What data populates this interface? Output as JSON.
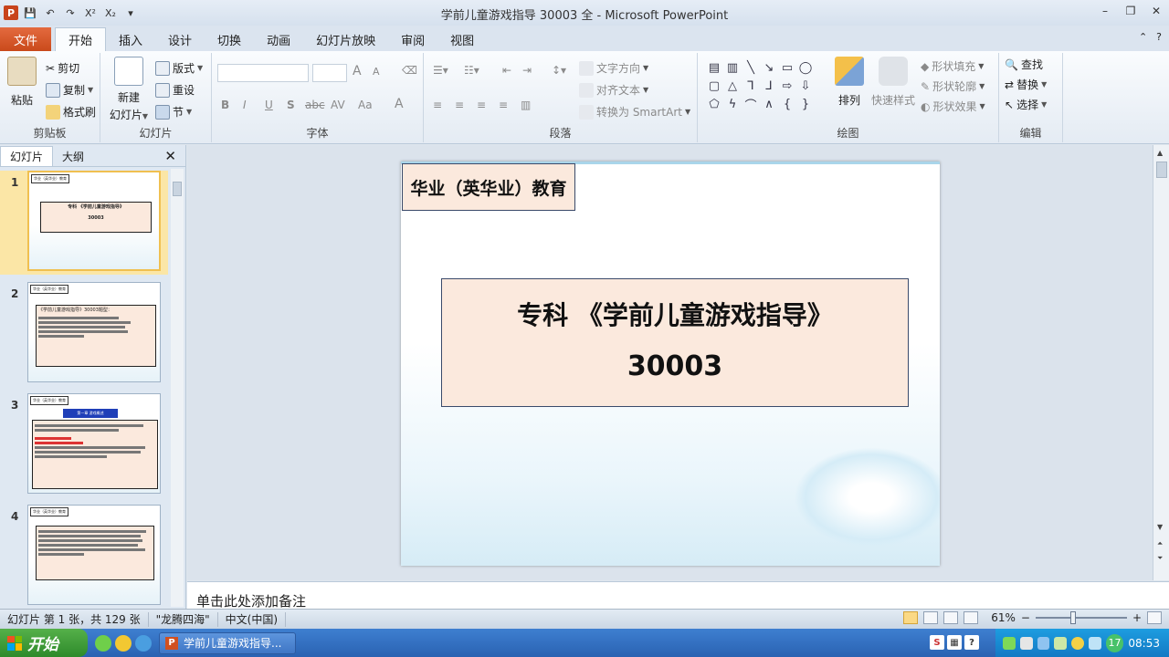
{
  "window": {
    "title": "学前儿童游戏指导  30003  全 - Microsoft PowerPoint",
    "app_logo": "P",
    "minimize_glyph": "–",
    "restore_glyph": "❐",
    "close_glyph": "✕",
    "help_glyph": "?",
    "collapse_glyph": "⌃"
  },
  "qat": {
    "save": "💾",
    "undo": "↶",
    "redo": "↷",
    "superscript": "X²",
    "subscript": "X₂",
    "customize": "▾"
  },
  "tabs": {
    "file": "文件",
    "home": "开始",
    "insert": "插入",
    "design": "设计",
    "transitions": "切换",
    "animations": "动画",
    "slideshow": "幻灯片放映",
    "review": "审阅",
    "view": "视图"
  },
  "ribbon": {
    "clipboard": {
      "label": "剪贴板",
      "paste": "粘贴",
      "cut": "剪切",
      "copy": "复制",
      "format_painter": "格式刷"
    },
    "slides": {
      "label": "幻灯片",
      "new_slide": "新建",
      "new_slide_sub": "幻灯片",
      "layout": "版式",
      "reset": "重设",
      "section": "节"
    },
    "font": {
      "label": "字体",
      "bold": "B",
      "italic": "I",
      "underline": "U",
      "shadow": "S",
      "strike": "abc",
      "spacing": "AV",
      "case": "Aa",
      "color": "A",
      "grow": "A",
      "shrink": "A"
    },
    "paragraph": {
      "label": "段落",
      "text_direction": "文字方向",
      "align_text": "对齐文本",
      "smartart": "转换为 SmartArt"
    },
    "drawing": {
      "label": "绘图",
      "arrange": "排列",
      "quick_styles": "快速样式",
      "shape_fill": "形状填充",
      "shape_outline": "形状轮廓",
      "shape_effects": "形状效果"
    },
    "editing": {
      "label": "编辑",
      "find": "查找",
      "replace": "替换",
      "select": "选择"
    }
  },
  "left_pane": {
    "tab_slides": "幻灯片",
    "tab_outline": "大纲",
    "close": "✕",
    "slides": [
      {
        "num": "1",
        "brand": "华业（英华业）教育",
        "title": "专科 《学前儿童游戏指导》",
        "code": "30003"
      },
      {
        "num": "2",
        "brand": "华业（英华业）教育",
        "text": "《学前儿童游戏指导》30003题型："
      },
      {
        "num": "3",
        "brand": "华业（英华业）教育",
        "heading": "第一章 游戏概述"
      },
      {
        "num": "4",
        "brand": "华业（英华业）教育"
      }
    ]
  },
  "slide": {
    "brand": "华业（英华业）教育",
    "line1": "专科  《学前儿童游戏指导》",
    "line2": "30003"
  },
  "notes": {
    "placeholder": "单击此处添加备注"
  },
  "status": {
    "slide_info": "幻灯片 第 1 张，共 129 张",
    "theme": "\"龙腾四海\"",
    "language": "中文(中国)",
    "zoom": "61%",
    "zoom_out": "−",
    "zoom_in": "+"
  },
  "taskbar": {
    "start": "开始",
    "task_item": "学前儿童游戏指导...",
    "notif_count": "17",
    "clock": "08:53"
  }
}
